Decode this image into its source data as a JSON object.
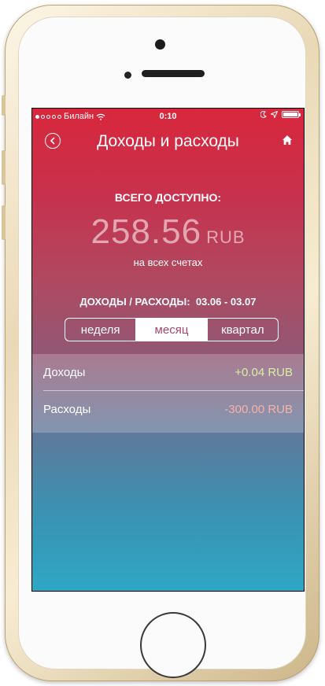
{
  "status_bar": {
    "carrier": "Билайн",
    "time": "0:10",
    "signal_dots": 5,
    "signal_filled": 1
  },
  "nav": {
    "title": "Доходы и расходы",
    "back_icon": "chevron-left-circle-icon",
    "home_icon": "home-icon"
  },
  "summary": {
    "label": "ВСЕГО ДОСТУПНО:",
    "amount": "258.56",
    "currency": "RUB",
    "subtitle": "на всех счетах"
  },
  "period": {
    "label": "ДОХОДЫ / РАСХОДЫ:",
    "range": "03.06 - 03.07",
    "options": [
      "неделя",
      "месяц",
      "квартал"
    ],
    "selected": "месяц"
  },
  "rows": [
    {
      "label": "Доходы",
      "value": "+0.04 RUB",
      "color": "#d6f0a0"
    },
    {
      "label": "Расходы",
      "value": "-300.00 RUB",
      "color": "#f7b1a5"
    }
  ],
  "colors": {
    "gradient_top": "#d8273c",
    "gradient_bottom": "#2ea7c4",
    "phone_frame": "#e9d9b6"
  }
}
